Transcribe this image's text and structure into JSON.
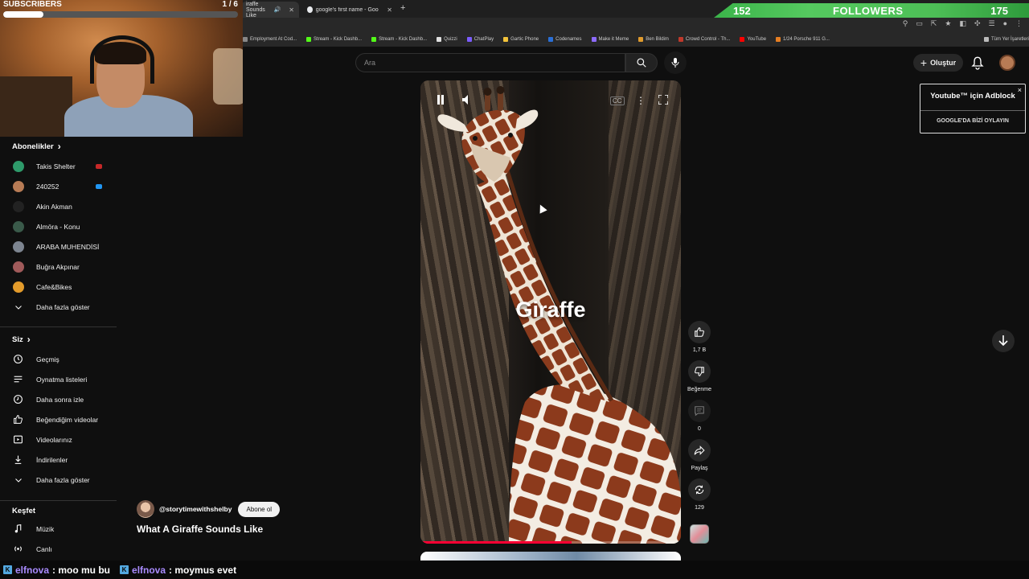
{
  "browser": {
    "tabs": [
      {
        "title": "iraffe Sounds Like",
        "active": true
      },
      {
        "title": "google's first name - Google S",
        "active": false
      }
    ],
    "bookmarks": [
      {
        "label": "Employment At Cod...",
        "color": "#888888"
      },
      {
        "label": "Stream - Kick Dashb...",
        "color": "#53fc18"
      },
      {
        "label": "Stream - Kick Dashb...",
        "color": "#53fc18"
      },
      {
        "label": "Quizzi",
        "color": "#e0e0e0"
      },
      {
        "label": "ChatPlay",
        "color": "#7b5cff"
      },
      {
        "label": "Gartic Phone",
        "color": "#f3c33a"
      },
      {
        "label": "Codenames",
        "color": "#2a6fd6"
      },
      {
        "label": "Make it Meme",
        "color": "#8d6bff"
      },
      {
        "label": "Ben Bildim",
        "color": "#e09b2d"
      },
      {
        "label": "Crowd Control - Th...",
        "color": "#c0392b"
      },
      {
        "label": "YouTube",
        "color": "#ff0000"
      },
      {
        "label": "1/24 Porsche 911 G...",
        "color": "#e67e22"
      },
      {
        "label": "Tüm Yer İşaretleri",
        "color": "#bbbbbb"
      }
    ]
  },
  "overlay": {
    "subscribers_label": "SUBSCRIBERS",
    "subscribers_count": "1 / 6",
    "subscribers_progress": 0.17,
    "followers_current": "152",
    "followers_label": "FOLLOWERS",
    "followers_goal": "175"
  },
  "youtube": {
    "search_placeholder": "Ara",
    "create_label": "Oluştur",
    "adblock": {
      "title": "Youtube™ için Adblock",
      "vote": "GOOGLE'DA BİZİ OYLAYIN",
      "close": "×"
    }
  },
  "sidebar": {
    "subscriptions_title": "Abonelikler",
    "subscriptions": [
      {
        "name": "Takis Shelter",
        "avatar": "#2e9a6a",
        "live": "#c62828"
      },
      {
        "name": "240252",
        "avatar": "#b77b55",
        "live": "#2196f3"
      },
      {
        "name": "Akin Akman",
        "avatar": "#222222"
      },
      {
        "name": "Almöra - Konu",
        "avatar": "#3a5a4a"
      },
      {
        "name": "ARABA MUHENDİSİ",
        "avatar": "#7d8590"
      },
      {
        "name": "Buğra Akpınar",
        "avatar": "#a05a5a"
      },
      {
        "name": "Cafe&Bikes",
        "avatar": "#e39b2b"
      }
    ],
    "show_more_1": "Daha fazla göster",
    "you_title": "Siz",
    "you_items": [
      {
        "label": "Geçmiş",
        "icon": "history-icon"
      },
      {
        "label": "Oynatma listeleri",
        "icon": "playlist-icon"
      },
      {
        "label": "Daha sonra izle",
        "icon": "watch-later-icon"
      },
      {
        "label": "Beğendiğim videolar",
        "icon": "like-icon"
      },
      {
        "label": "Videolarınız",
        "icon": "your-videos-icon"
      },
      {
        "label": "İndirilenler",
        "icon": "download-icon"
      }
    ],
    "show_more_2": "Daha fazla göster",
    "explore_title": "Keşfet",
    "explore_items": [
      {
        "label": "Müzik",
        "icon": "music-icon"
      },
      {
        "label": "Canlı",
        "icon": "live-icon"
      }
    ]
  },
  "short": {
    "overlay_title": "Giraffe",
    "progress": 0.58,
    "channel": "@storytimewithshelby",
    "subscribe_label": "Abone ol",
    "video_title": "What A Giraffe Sounds Like",
    "actions": {
      "likes": "1,7 B",
      "dislike_label": "Beğenme",
      "comments": "0",
      "share_label": "Paylaş",
      "remix": "129"
    }
  },
  "chat": [
    {
      "user": "elfnova",
      "message": ": moo mu bu"
    },
    {
      "user": "elfnova",
      "message": ": moymus evet"
    }
  ]
}
